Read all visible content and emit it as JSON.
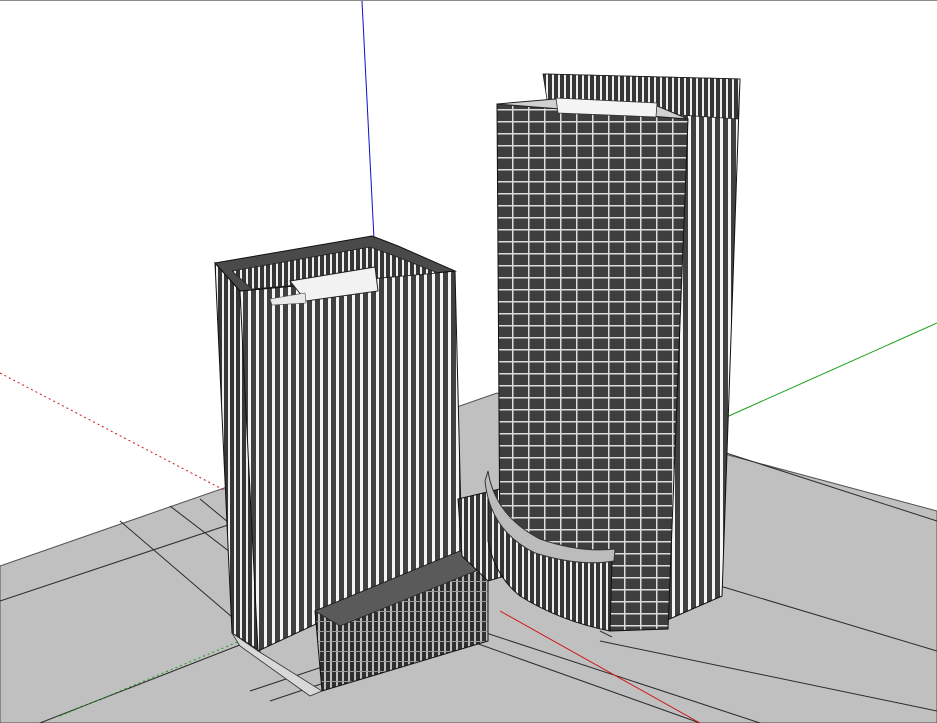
{
  "scene": {
    "ground_color": "#c0c0c0",
    "axis_colors": {
      "blue": "#1010c8",
      "red": "#d01818",
      "green": "#18a018"
    },
    "model": {
      "building_left": "tower-block",
      "building_right": "curved-base-tower",
      "facade_color": "#3b3b3b",
      "mullion_color": "#f2f2f2",
      "roof_color": "#efefef"
    }
  }
}
